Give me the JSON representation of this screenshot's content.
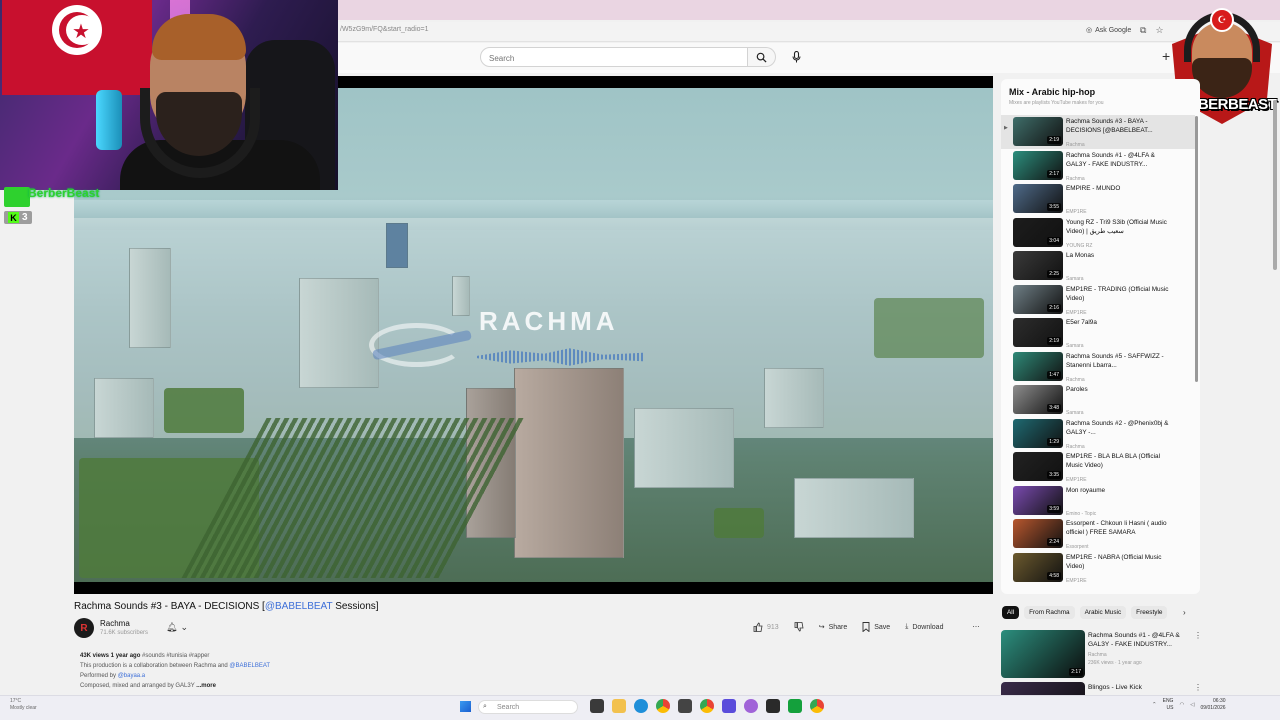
{
  "browser": {
    "url_fragment": "/W5zG9m/FQ&start_radio=1",
    "ask_google": "Ask Google"
  },
  "youtube": {
    "search_placeholder": "Search"
  },
  "stream_overlay": {
    "name": "BerberBeast",
    "kick_viewers": "3",
    "logo_text": "BERBERBEAST"
  },
  "video": {
    "overlay_brand": "RACHMA",
    "title_prefix": "Rachma Sounds #3 - BAYA - DECISIONS [",
    "title_tag": "@BABELBEAT",
    "title_suffix": " Sessions]",
    "channel": "Rachma",
    "subscribers": "71.6K subscribers",
    "actions": {
      "likes": "913",
      "share": "Share",
      "save": "Save",
      "download": "Download"
    },
    "description": {
      "stats": "43K views  1 year ago",
      "hashtags": "#sounds #tunisia #rapper",
      "line1_prefix": "This production is a collaboration between Rachma and ",
      "line1_tag": "@BABELBEAT",
      "line2_prefix": "Performed by ",
      "line2_tag": "@bayaa.a",
      "line3": "Composed, mixed and arranged by GAL3Y",
      "more": "...more"
    }
  },
  "playlist": {
    "title": "Mix - Arabic hip-hop",
    "subtitle": "Mixes are playlists YouTube makes for you",
    "items": [
      {
        "title": "Rachma Sounds #3 - BAYA - DECISIONS [@BABELBEAT...",
        "channel": "Rachma",
        "duration": "2:19",
        "color": "#3f6e6a",
        "current": true
      },
      {
        "title": "Rachma Sounds #1 - @4LFA & GAL3Y - FAKE INDUSTRY...",
        "channel": "Rachma",
        "duration": "2:17",
        "color": "#2c8f7e"
      },
      {
        "title": "EMPIRE - MUNDO",
        "channel": "EMP1RE",
        "duration": "3:55",
        "color": "#4f6b8a"
      },
      {
        "title": "Young RZ - Tri9 S3ib (Official Music Video) | سعيب طريق",
        "channel": "YOUNG RZ",
        "duration": "3:04",
        "color": "#1d1d1d"
      },
      {
        "title": "La Monas",
        "channel": "Samara",
        "duration": "2:25",
        "color": "#3a3a3a"
      },
      {
        "title": "EMP1RE - TRADING (Official Music Video)",
        "channel": "EMP1RE",
        "duration": "2:16",
        "color": "#6f7f86"
      },
      {
        "title": "E5er 7al9a",
        "channel": "Samara",
        "duration": "2:19",
        "color": "#2d2d2d"
      },
      {
        "title": "Rachma Sounds #5 - SAFFWIZZ - Stanenni Lbarra...",
        "channel": "Rachma",
        "duration": "1:47",
        "color": "#2f8a78"
      },
      {
        "title": "Paroles",
        "channel": "Samara",
        "duration": "3:48",
        "color": "#8e8e8e"
      },
      {
        "title": "Rachma Sounds #2 - @Phenix0bj & GAL3Y -...",
        "channel": "Rachma",
        "duration": "1:29",
        "color": "#1f6a72"
      },
      {
        "title": "EMP1RE - BLA BLA BLA (Official Music Video)",
        "channel": "EMP1RE",
        "duration": "3:35",
        "color": "#222222"
      },
      {
        "title": "Mon royaume",
        "channel": "Emino - Topic",
        "duration": "3:59",
        "color": "#7a4bb0"
      },
      {
        "title": "Essorpent - Chkoun li Hasni ( audio officiel ) FREE SAMARA",
        "channel": "Essorpent",
        "duration": "2:24",
        "color": "#b8572e"
      },
      {
        "title": "EMP1RE - NABRA (Official Music Video)",
        "channel": "EMP1RE",
        "duration": "4:58",
        "color": "#6c5a2e"
      }
    ]
  },
  "chips": [
    "All",
    "From Rachma",
    "Arabic Music",
    "Freestyle"
  ],
  "recommendations": [
    {
      "title": "Rachma Sounds #1 - @4LFA & GAL3Y - FAKE INDUSTRY...",
      "channel": "Rachma",
      "meta": "236K views · 1 year ago",
      "duration": "2:17",
      "color": "#2c8f7e"
    },
    {
      "title": "Blingos - Live Kick",
      "channel": "",
      "meta": "",
      "duration": "",
      "color": "#3a2b4a"
    }
  ],
  "taskbar": {
    "weather_temp": "17°C",
    "weather_desc": "Mostly clear",
    "search_label": "Search",
    "lang": "ENG",
    "region": "US",
    "time": "06:30",
    "date": "09/01/2026"
  }
}
